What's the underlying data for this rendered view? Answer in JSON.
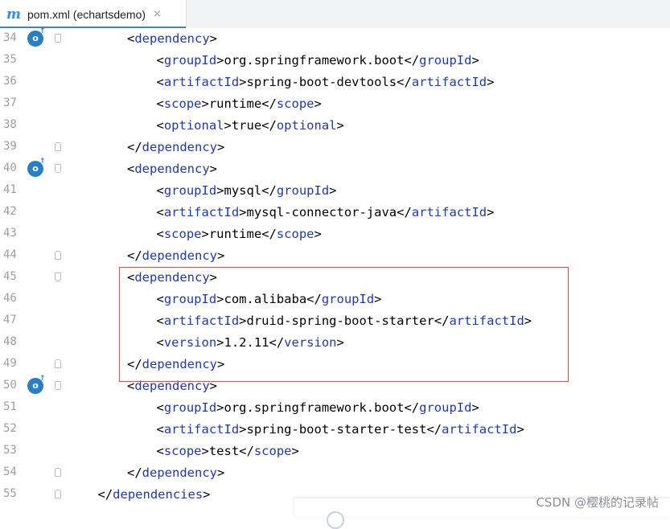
{
  "tab": {
    "icon": "maven-m-icon",
    "icon_glyph": "m",
    "title": "pom.xml (echartsdemo)",
    "close_glyph": "×"
  },
  "lines": [
    {
      "num": "34",
      "indent": 2,
      "impl": true,
      "fold": "open",
      "parts": [
        [
          "b",
          "<"
        ],
        [
          "t",
          "dependency"
        ],
        [
          "b",
          ">"
        ]
      ]
    },
    {
      "num": "35",
      "indent": 3,
      "parts": [
        [
          "b",
          "<"
        ],
        [
          "t",
          "groupId"
        ],
        [
          "b",
          ">org.springframework.boot</"
        ],
        [
          "t",
          "groupId"
        ],
        [
          "b",
          ">"
        ]
      ]
    },
    {
      "num": "36",
      "indent": 3,
      "parts": [
        [
          "b",
          "<"
        ],
        [
          "t",
          "artifactId"
        ],
        [
          "b",
          ">spring-boot-devtools</"
        ],
        [
          "t",
          "artifactId"
        ],
        [
          "b",
          ">"
        ]
      ]
    },
    {
      "num": "37",
      "indent": 3,
      "parts": [
        [
          "b",
          "<"
        ],
        [
          "t",
          "scope"
        ],
        [
          "b",
          ">runtime</"
        ],
        [
          "t",
          "scope"
        ],
        [
          "b",
          ">"
        ]
      ]
    },
    {
      "num": "38",
      "indent": 3,
      "parts": [
        [
          "b",
          "<"
        ],
        [
          "t",
          "optional"
        ],
        [
          "b",
          ">true</"
        ],
        [
          "t",
          "optional"
        ],
        [
          "b",
          ">"
        ]
      ]
    },
    {
      "num": "39",
      "indent": 2,
      "fold": "close",
      "parts": [
        [
          "b",
          "</"
        ],
        [
          "t",
          "dependency"
        ],
        [
          "b",
          ">"
        ]
      ]
    },
    {
      "num": "40",
      "indent": 2,
      "impl": true,
      "fold": "open",
      "parts": [
        [
          "b",
          "<"
        ],
        [
          "t",
          "dependency"
        ],
        [
          "b",
          ">"
        ]
      ]
    },
    {
      "num": "41",
      "indent": 3,
      "parts": [
        [
          "b",
          "<"
        ],
        [
          "t",
          "groupId"
        ],
        [
          "b",
          ">mysql</"
        ],
        [
          "t",
          "groupId"
        ],
        [
          "b",
          ">"
        ]
      ]
    },
    {
      "num": "42",
      "indent": 3,
      "parts": [
        [
          "b",
          "<"
        ],
        [
          "t",
          "artifactId"
        ],
        [
          "b",
          ">mysql-connector-java</"
        ],
        [
          "t",
          "artifactId"
        ],
        [
          "b",
          ">"
        ]
      ]
    },
    {
      "num": "43",
      "indent": 3,
      "parts": [
        [
          "b",
          "<"
        ],
        [
          "t",
          "scope"
        ],
        [
          "b",
          ">runtime</"
        ],
        [
          "t",
          "scope"
        ],
        [
          "b",
          ">"
        ]
      ]
    },
    {
      "num": "44",
      "indent": 2,
      "fold": "close",
      "parts": [
        [
          "b",
          "</"
        ],
        [
          "t",
          "dependency"
        ],
        [
          "b",
          ">"
        ]
      ]
    },
    {
      "num": "45",
      "indent": 2,
      "fold": "open",
      "parts": [
        [
          "b",
          "<"
        ],
        [
          "t",
          "dependency"
        ],
        [
          "b",
          ">"
        ]
      ]
    },
    {
      "num": "46",
      "indent": 3,
      "parts": [
        [
          "b",
          "<"
        ],
        [
          "t",
          "groupId"
        ],
        [
          "b",
          ">com.alibaba</"
        ],
        [
          "t",
          "groupId"
        ],
        [
          "b",
          ">"
        ]
      ]
    },
    {
      "num": "47",
      "indent": 3,
      "parts": [
        [
          "b",
          "<"
        ],
        [
          "t",
          "artifactId"
        ],
        [
          "b",
          ">druid-spring-boot-starter</"
        ],
        [
          "t",
          "artifactId"
        ],
        [
          "b",
          ">"
        ]
      ]
    },
    {
      "num": "48",
      "indent": 3,
      "parts": [
        [
          "b",
          "<"
        ],
        [
          "t",
          "version"
        ],
        [
          "b",
          ">1.2.11</"
        ],
        [
          "t",
          "version"
        ],
        [
          "b",
          ">"
        ]
      ]
    },
    {
      "num": "49",
      "indent": 2,
      "fold": "close",
      "parts": [
        [
          "b",
          "</"
        ],
        [
          "t",
          "dependency"
        ],
        [
          "b",
          ">"
        ]
      ]
    },
    {
      "num": "50",
      "indent": 2,
      "impl": true,
      "fold": "open",
      "parts": [
        [
          "b",
          "<"
        ],
        [
          "t",
          "dependency"
        ],
        [
          "b",
          ">"
        ]
      ]
    },
    {
      "num": "51",
      "indent": 3,
      "parts": [
        [
          "b",
          "<"
        ],
        [
          "t",
          "groupId"
        ],
        [
          "b",
          ">org.springframework.boot</"
        ],
        [
          "t",
          "groupId"
        ],
        [
          "b",
          ">"
        ]
      ]
    },
    {
      "num": "52",
      "indent": 3,
      "parts": [
        [
          "b",
          "<"
        ],
        [
          "t",
          "artifactId"
        ],
        [
          "b",
          ">spring-boot-starter-test</"
        ],
        [
          "t",
          "artifactId"
        ],
        [
          "b",
          ">"
        ]
      ]
    },
    {
      "num": "53",
      "indent": 3,
      "parts": [
        [
          "b",
          "<"
        ],
        [
          "t",
          "scope"
        ],
        [
          "b",
          ">test</"
        ],
        [
          "t",
          "scope"
        ],
        [
          "b",
          ">"
        ]
      ]
    },
    {
      "num": "54",
      "indent": 2,
      "fold": "close",
      "parts": [
        [
          "b",
          "</"
        ],
        [
          "t",
          "dependency"
        ],
        [
          "b",
          ">"
        ]
      ]
    },
    {
      "num": "55",
      "indent": 1,
      "fold": "close",
      "parts": [
        [
          "b",
          "</"
        ],
        [
          "t",
          "dependencies"
        ],
        [
          "b",
          ">"
        ]
      ]
    }
  ],
  "gutter_icons": {
    "implementation": "maven-dependency-icon",
    "glyph": "o",
    "arrow": "↑"
  },
  "highlight": {
    "color": "#e04a4a",
    "from_line": "45",
    "to_line": "49"
  },
  "colors": {
    "tag": "#1f38b8",
    "text": "#000000",
    "line_number": "#9aa0a6",
    "accent": "#4083c9"
  },
  "watermark": "CSDN @樱桃的记录帖"
}
